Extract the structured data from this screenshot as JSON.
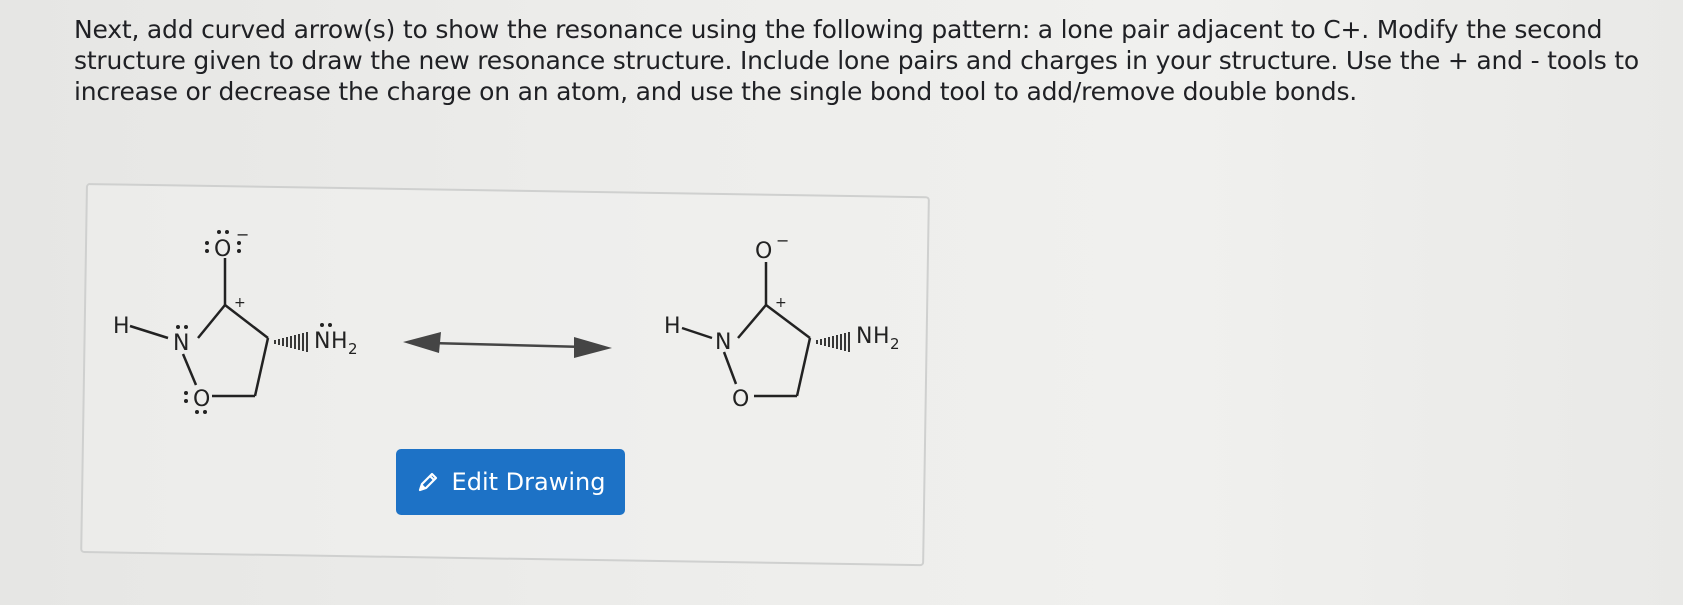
{
  "question": {
    "line1": "Next, add curved arrow(s) to show the resonance using the following pattern: a lone pair adjacent to C+. Modify the second",
    "line2": "structure given to draw the new resonance structure. Include lone pairs and charges in your structure. Use the + and - tools to",
    "line3": "increase or decrease the charge on an atom, and use the single bond tool to add/remove double bonds."
  },
  "left_structure": {
    "atom_o_top": "O",
    "charge_o": "−",
    "charge_c": "+",
    "atom_h": "H",
    "atom_n": "N",
    "atom_o_ring": "O",
    "nh2_n": "N",
    "nh2_h": "H",
    "nh2_sub": "2"
  },
  "right_structure": {
    "atom_o_top": "O",
    "charge_o": "−",
    "charge_c": "+",
    "atom_h": "H",
    "atom_n": "N",
    "atom_o_ring": "O",
    "nh2_n": "N",
    "nh2_h": "H",
    "nh2_sub": "2"
  },
  "edit_button": {
    "label": "Edit Drawing",
    "icon": "pencil-icon"
  },
  "colors": {
    "button": "#1d72c6",
    "text": "#1f2024",
    "arrow": "#454545"
  }
}
